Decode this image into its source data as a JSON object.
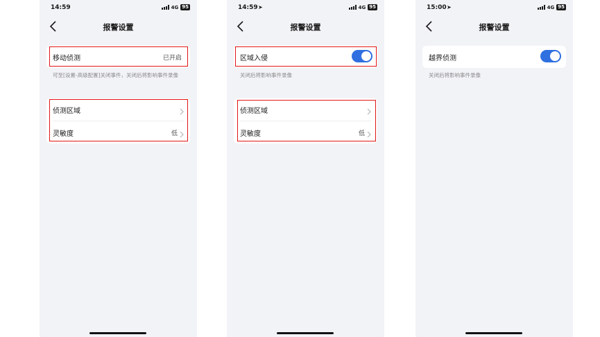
{
  "screens": [
    {
      "status": {
        "time": "14:59",
        "network": "4G",
        "battery": "95"
      },
      "title": "报警设置",
      "main_label": "移动侦测",
      "main_value": "已开启",
      "description": "可至[设置-高级配置]关闭事件，关闭后将影响事件录像",
      "rows": [
        {
          "label": "侦测区域",
          "value": ""
        },
        {
          "label": "灵敏度",
          "value": "低"
        }
      ]
    },
    {
      "status": {
        "time": "14:59",
        "network": "4G",
        "battery": "95"
      },
      "title": "报警设置",
      "main_label": "区域入侵",
      "toggle_on": true,
      "description": "关闭后将影响事件录像",
      "rows": [
        {
          "label": "侦测区域",
          "value": ""
        },
        {
          "label": "灵敏度",
          "value": "低"
        }
      ]
    },
    {
      "status": {
        "time": "15:00",
        "network": "4G",
        "battery": "95"
      },
      "title": "报警设置",
      "main_label": "越界侦测",
      "toggle_on": true,
      "description": "关闭后将影响事件录像"
    }
  ],
  "colors": {
    "accent": "#2f6fe0",
    "highlight": "#e11414",
    "background": "#f2f3f7"
  },
  "icons": {
    "back": "chevron-left-icon",
    "row": "chevron-right-icon",
    "location": "location-arrow-icon"
  }
}
